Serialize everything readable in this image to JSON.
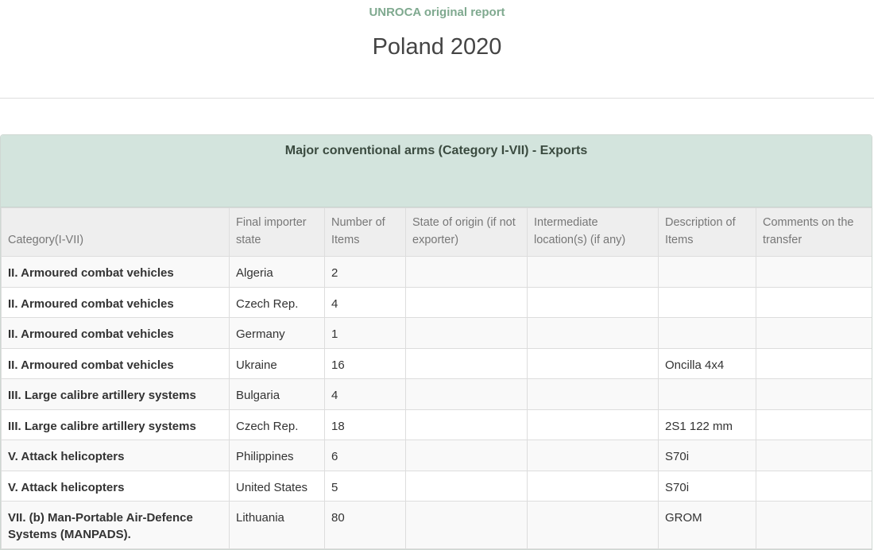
{
  "header": {
    "subtitle": "UNROCA original report",
    "title": "Poland 2020"
  },
  "panel": {
    "heading": "Major conventional arms (Category I-VII) - Exports"
  },
  "table": {
    "columns": [
      "Category(I-VII)",
      "Final importer state",
      "Number of Items",
      "State of origin (if not exporter)",
      "Intermediate location(s) (if any)",
      "Description of Items",
      "Comments on the transfer"
    ],
    "rows": [
      {
        "category": "II. Armoured combat vehicles",
        "importer": "Algeria",
        "items": "2",
        "origin": "",
        "intermediate": "",
        "description": "",
        "comments": ""
      },
      {
        "category": "II. Armoured combat vehicles",
        "importer": "Czech Rep.",
        "items": "4",
        "origin": "",
        "intermediate": "",
        "description": "",
        "comments": ""
      },
      {
        "category": "II. Armoured combat vehicles",
        "importer": "Germany",
        "items": "1",
        "origin": "",
        "intermediate": "",
        "description": "",
        "comments": ""
      },
      {
        "category": "II. Armoured combat vehicles",
        "importer": "Ukraine",
        "items": "16",
        "origin": "",
        "intermediate": "",
        "description": "Oncilla 4x4",
        "comments": ""
      },
      {
        "category": "III. Large calibre artillery systems",
        "importer": "Bulgaria",
        "items": "4",
        "origin": "",
        "intermediate": "",
        "description": "",
        "comments": ""
      },
      {
        "category": "III. Large calibre artillery systems",
        "importer": "Czech Rep.",
        "items": "18",
        "origin": "",
        "intermediate": "",
        "description": "2S1 122 mm",
        "comments": ""
      },
      {
        "category": "V. Attack helicopters",
        "importer": "Philippines",
        "items": "6",
        "origin": "",
        "intermediate": "",
        "description": "S70i",
        "comments": ""
      },
      {
        "category": "V. Attack helicopters",
        "importer": "United States",
        "items": "5",
        "origin": "",
        "intermediate": "",
        "description": "S70i",
        "comments": ""
      },
      {
        "category": "VII. (b) Man-Portable Air-Defence Systems (MANPADS).",
        "importer": "Lithuania",
        "items": "80",
        "origin": "",
        "intermediate": "",
        "description": "GROM",
        "comments": ""
      }
    ]
  }
}
